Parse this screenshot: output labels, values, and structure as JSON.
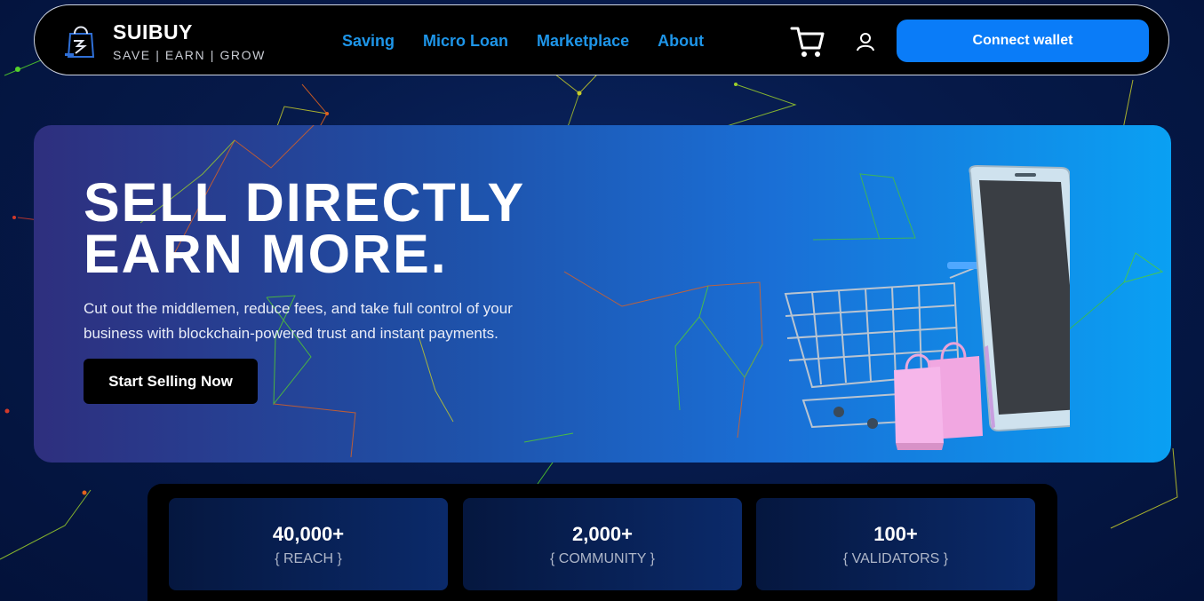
{
  "header": {
    "brand_name": "SUIBUY",
    "tagline": "SAVE | EARN | GROW",
    "nav": [
      "Saving",
      "Micro Loan",
      "Marketplace",
      "About"
    ],
    "connect_label": "Connect wallet"
  },
  "hero": {
    "title_line1": "SELL DIRECTLY",
    "title_line2": "EARN MORE.",
    "description": "Cut out the middlemen, reduce fees, and take full control of your business with blockchain-powered trust and instant payments.",
    "cta_label": "Start Selling Now"
  },
  "stats": [
    {
      "value": "40,000+",
      "label": "{ REACH }"
    },
    {
      "value": "2,000+",
      "label": "{ COMMUNITY }"
    },
    {
      "value": "100+",
      "label": "{ VALIDATORS }"
    }
  ],
  "colors": {
    "accent": "#0a7cf8",
    "nav_link": "#1e95e8",
    "background": "#03143d"
  },
  "icons": [
    "shopping-bag-logo-icon",
    "cart-icon",
    "user-icon"
  ]
}
